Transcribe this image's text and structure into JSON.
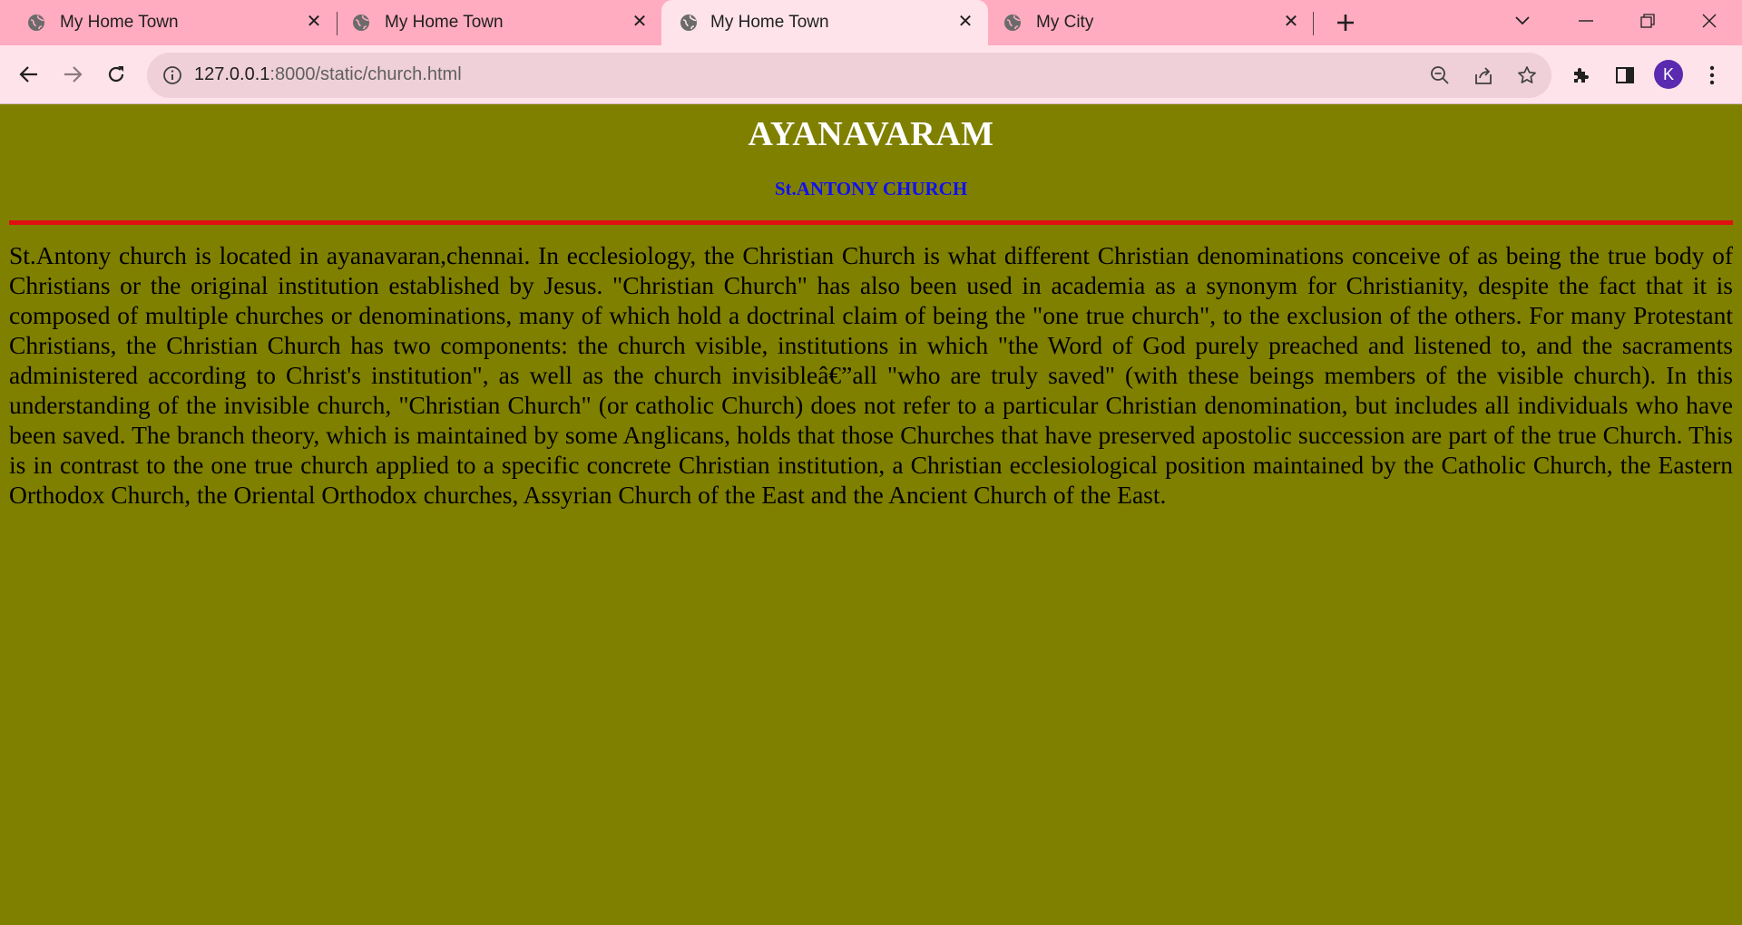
{
  "browser": {
    "tabs": [
      {
        "title": "My Home Town",
        "active": false
      },
      {
        "title": "My Home Town",
        "active": false
      },
      {
        "title": "My Home Town",
        "active": true
      },
      {
        "title": "My City",
        "active": false
      }
    ],
    "new_tab": "+",
    "address": {
      "host": "127.0.0.1",
      "path": ":8000/static/church.html"
    },
    "profile_initial": "K",
    "icons": [
      "globe-icon",
      "close-icon",
      "plus-icon",
      "chevron-down-icon",
      "minimize-icon",
      "restore-icon",
      "window-close-icon",
      "back-arrow-icon",
      "forward-arrow-icon",
      "reload-icon",
      "info-icon",
      "zoom-out-icon",
      "share-icon",
      "star-icon",
      "puzzle-icon",
      "side-panel-icon",
      "kebab-menu-icon"
    ],
    "colors": {
      "tabstrip": "#ffacc0",
      "toolbar": "#ffe3ea",
      "omnibox": "#efd0d8",
      "avatar": "#5a2ab0"
    }
  },
  "page": {
    "heading": "AYANAVARAM",
    "subheading": "St.ANTONY CHURCH",
    "body": "St.Antony church is located in ayanavaran,chennai. In ecclesiology, the Christian Church is what different Christian denominations conceive of as being the true body of Christians or the original institution established by Jesus. \"Christian Church\" has also been used in academia as a synonym for Christianity, despite the fact that it is composed of multiple churches or denominations, many of which hold a doctrinal claim of being the \"one true church\", to the exclusion of the others. For many Protestant Christians, the Christian Church has two components: the church visible, institutions in which \"the Word of God purely preached and listened to, and the sacraments administered according to Christ's institution\", as well as the church invisibleâ€”all \"who are truly saved\" (with these beings members of the visible church). In this understanding of the invisible church, \"Christian Church\" (or catholic Church) does not refer to a particular Christian denomination, but includes all individuals who have been saved. The branch theory, which is maintained by some Anglicans, holds that those Churches that have preserved apostolic succession are part of the true Church. This is in contrast to the one true church applied to a specific concrete Christian institution, a Christian ecclesiological position maintained by the Catholic Church, the Eastern Orthodox Church, the Oriental Orthodox churches, Assyrian Church of the East and the Ancient Church of the East.",
    "colors": {
      "background": "#808000",
      "heading": "#ffffff",
      "subheading": "#1010f0",
      "rule": "#e01010",
      "text": "#000000"
    }
  }
}
